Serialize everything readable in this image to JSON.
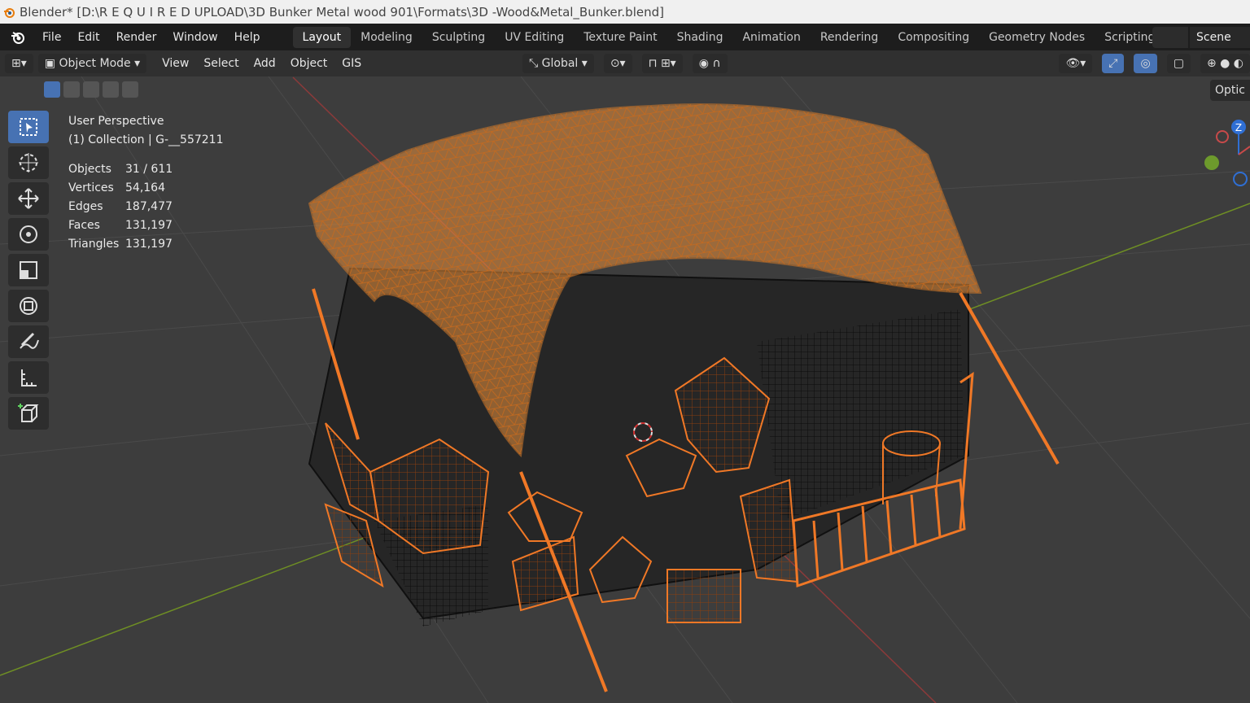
{
  "title_bar": {
    "text": "Blender* [D:\\R E Q U I R E D   UPLOAD\\3D Bunker Metal wood 901\\Formats\\3D -Wood&Metal_Bunker.blend]"
  },
  "menu": [
    "File",
    "Edit",
    "Render",
    "Window",
    "Help"
  ],
  "workspaces": [
    "Layout",
    "Modeling",
    "Sculpting",
    "UV Editing",
    "Texture Paint",
    "Shading",
    "Animation",
    "Rendering",
    "Compositing",
    "Geometry Nodes",
    "Scripting"
  ],
  "active_workspace": "Layout",
  "scene": {
    "name": "Scene"
  },
  "viewport_header": {
    "mode": "Object Mode",
    "menus": [
      "View",
      "Select",
      "Add",
      "Object",
      "GIS"
    ],
    "orientation": "Global",
    "options_label": "Optic"
  },
  "overlay": {
    "perspective": "User Perspective",
    "collection": "(1) Collection | G-__557211",
    "stats": [
      {
        "label": "Objects",
        "value": "31 / 611"
      },
      {
        "label": "Vertices",
        "value": "54,164"
      },
      {
        "label": "Edges",
        "value": "187,477"
      },
      {
        "label": "Faces",
        "value": "131,197"
      },
      {
        "label": "Triangles",
        "value": "131,197"
      }
    ]
  },
  "gizmo": {
    "z_label": "Z"
  },
  "colors": {
    "accent": "#4772b3",
    "selection": "#f07826",
    "mesh_orange": "#e8903c",
    "background": "#3d3d3d"
  }
}
